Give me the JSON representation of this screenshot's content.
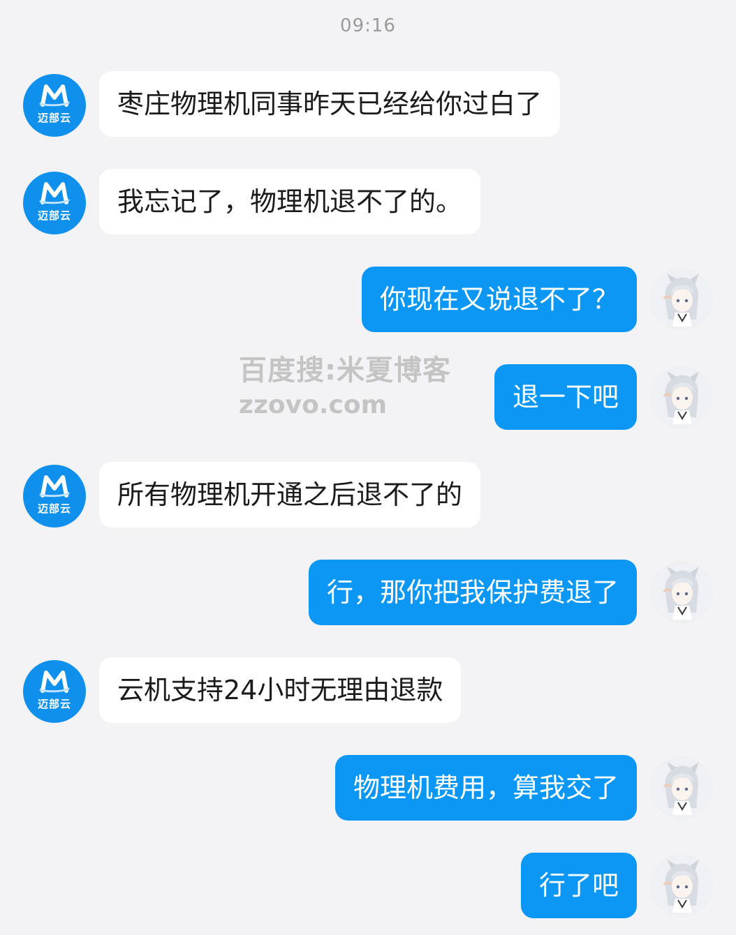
{
  "chat": {
    "timestamp": "09:16",
    "contact_brand": "迈部云",
    "messages": [
      {
        "side": "in",
        "text": "枣庄物理机同事昨天已经给你过白了"
      },
      {
        "side": "in",
        "text": "我忘记了，物理机退不了的。"
      },
      {
        "side": "out",
        "text": "你现在又说退不了？"
      },
      {
        "side": "out",
        "text": "退一下吧"
      },
      {
        "side": "in",
        "text": "所有物理机开通之后退不了的"
      },
      {
        "side": "out",
        "text": "行，那你把我保护费退了"
      },
      {
        "side": "in",
        "text": "云机支持24小时无理由退款"
      },
      {
        "side": "out",
        "text": "物理机费用，算我交了"
      },
      {
        "side": "out",
        "text": "行了吧"
      }
    ]
  },
  "watermark": {
    "line1": "百度搜:米夏博客",
    "line2": "zzovo.com"
  },
  "colors": {
    "outgoing_bubble": "#0c97f5",
    "incoming_bubble": "#ffffff",
    "brand_avatar": "#0e90ec",
    "background": "#f3f3f5"
  },
  "icons": {
    "contact_avatar": "maibu-cloud-logo-icon",
    "user_avatar": "anime-girl-avatar-icon"
  }
}
